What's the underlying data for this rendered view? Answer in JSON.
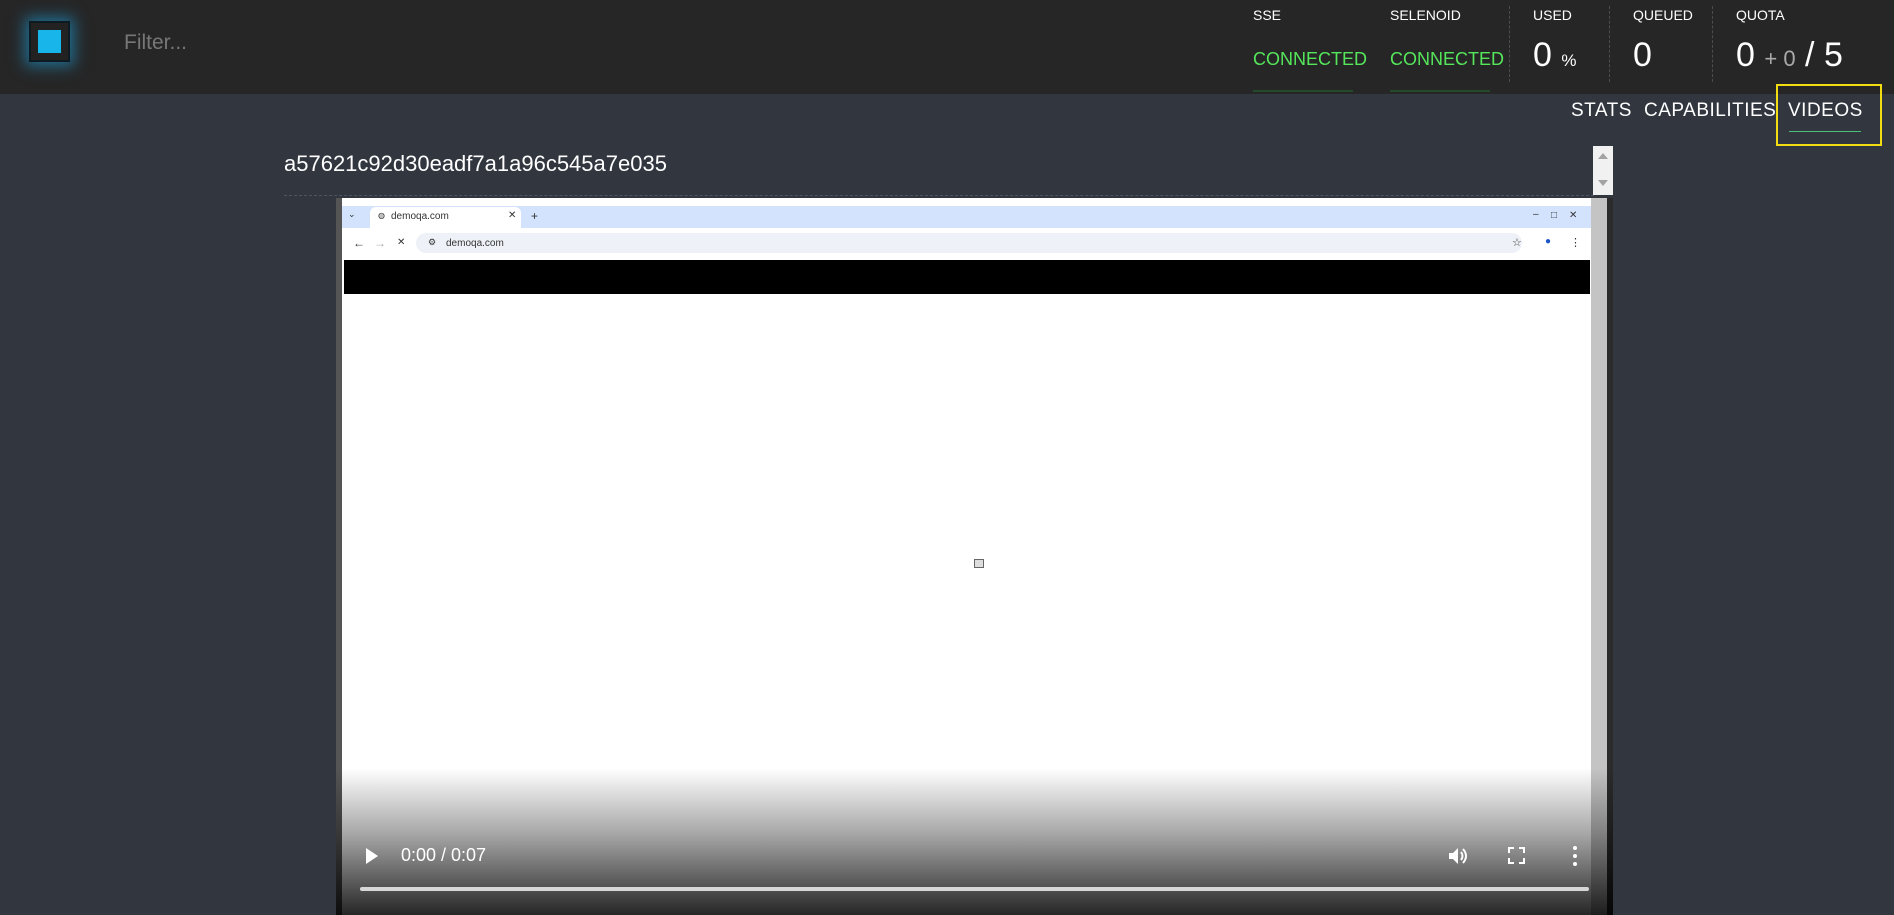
{
  "header": {
    "filter_placeholder": "Filter...",
    "stats": {
      "sse": {
        "label": "SSE",
        "value": "CONNECTED"
      },
      "selenoid": {
        "label": "SELENOID",
        "value": "CONNECTED"
      },
      "used": {
        "label": "USED",
        "value": "0",
        "unit": "%"
      },
      "queued": {
        "label": "QUEUED",
        "value": "0"
      },
      "quota": {
        "label": "QUOTA",
        "value": "0",
        "pending": "+ 0",
        "separator": "/",
        "total": "5"
      }
    },
    "accent_color": "#17b5ea",
    "connected_color": "#55e65b"
  },
  "nav": {
    "tabs": [
      {
        "label": "STATS"
      },
      {
        "label": "CAPABILITIES"
      },
      {
        "label": "VIDEOS",
        "active": true
      }
    ],
    "highlight_color": "#f1dd12"
  },
  "session": {
    "id": "a57621c92d30eadf7a1a96c545a7e035"
  },
  "video": {
    "browser_tab_title": "demoqa.com",
    "address": "demoqa.com",
    "time": "0:00 / 0:07",
    "progress": 0.0
  }
}
